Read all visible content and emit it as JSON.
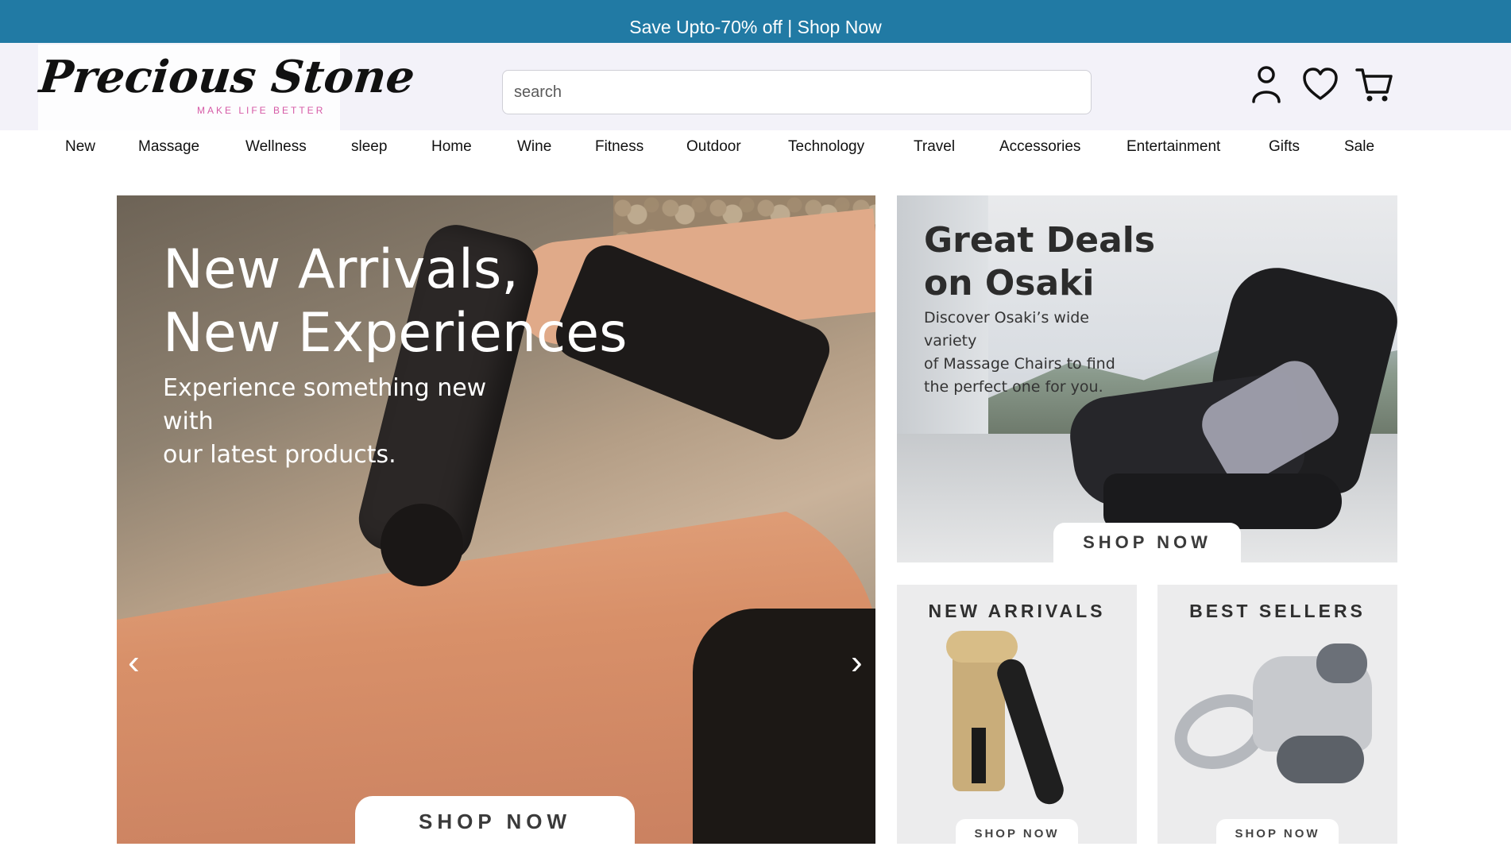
{
  "promo_bar": {
    "text": "Save Upto-70% off | Shop Now"
  },
  "header": {
    "logo": {
      "name": "Precious Stone",
      "tagline": "MAKE LIFE BETTER"
    },
    "search": {
      "placeholder": "search",
      "value": ""
    },
    "icons": [
      "user-icon",
      "heart-icon",
      "cart-icon"
    ]
  },
  "nav": {
    "items": [
      "New",
      "Massage",
      "Wellness",
      "sleep",
      "Home",
      "Wine",
      "Fitness",
      "Outdoor",
      "Technology",
      "Travel",
      "Accessories",
      "Entertainment",
      "Gifts",
      "Sale"
    ]
  },
  "hero": {
    "title_line1": "New Arrivals,",
    "title_line2": "New Experiences",
    "subtitle_line1": "Experience something new with",
    "subtitle_line2": "our latest products.",
    "prev_arrow": "‹",
    "next_arrow": "›",
    "button": "SHOP NOW"
  },
  "promo_osaki": {
    "title_line1": "Great Deals",
    "title_line2": "on Osaki",
    "desc_line1": "Discover Osaki’s wide variety",
    "desc_line2": "of Massage Chairs to find",
    "desc_line3": "the perfect one for you.",
    "button": "SHOP NOW"
  },
  "tiles": [
    {
      "title": "NEW ARRIVALS",
      "button": "SHOP NOW"
    },
    {
      "title": "BEST SELLERS",
      "button": "SHOP NOW"
    }
  ],
  "colors": {
    "promo_bar": "#217aa4",
    "header_bg": "#f3f2f9",
    "tagline": "#d65aa6"
  }
}
